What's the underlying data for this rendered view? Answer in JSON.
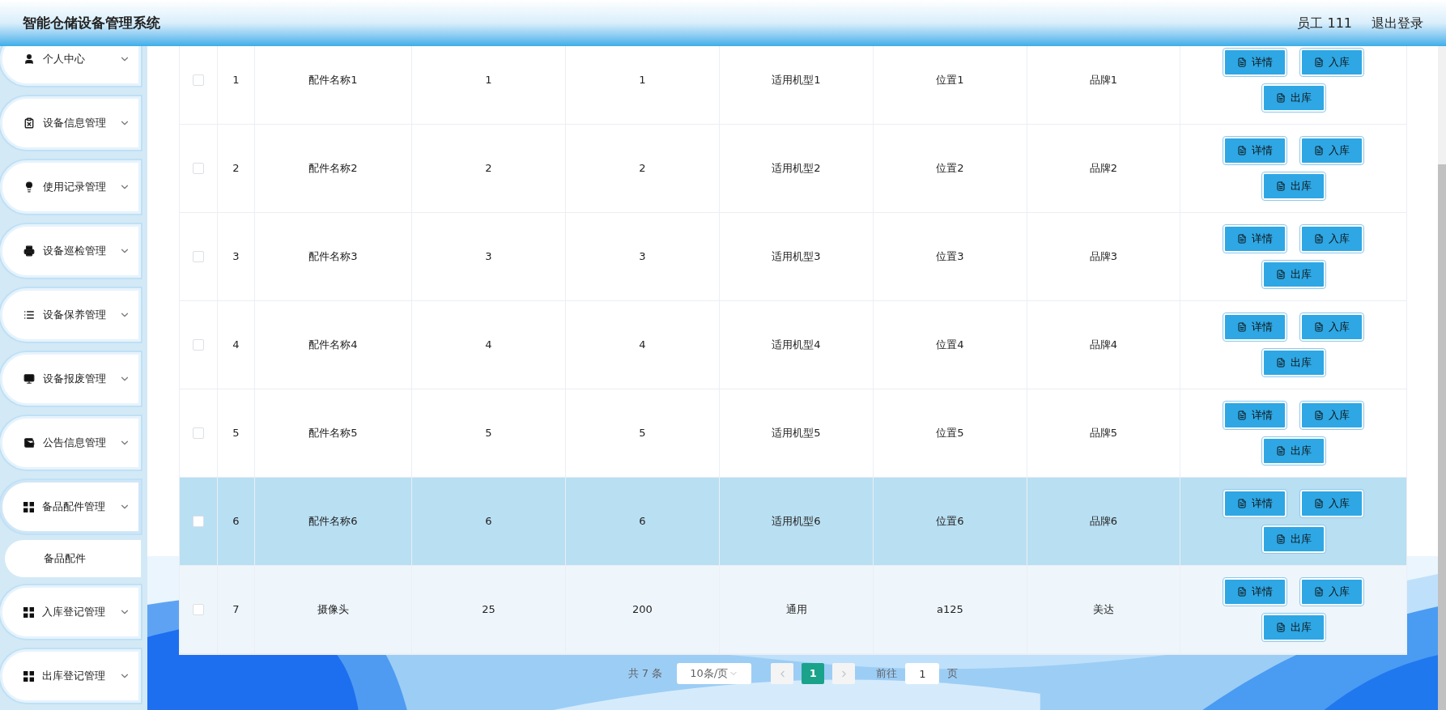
{
  "header": {
    "title": "智能仓储设备管理系统",
    "user": "员工 111",
    "logout": "退出登录"
  },
  "sidebar": {
    "items": [
      {
        "label": "个人中心",
        "expanded": false
      },
      {
        "label": "设备信息管理",
        "expanded": false
      },
      {
        "label": "使用记录管理",
        "expanded": false
      },
      {
        "label": "设备巡检管理",
        "expanded": false
      },
      {
        "label": "设备保养管理",
        "expanded": false
      },
      {
        "label": "设备报废管理",
        "expanded": false
      },
      {
        "label": "公告信息管理",
        "expanded": false
      },
      {
        "label": "备品配件管理",
        "expanded": true,
        "children": [
          {
            "label": "备品配件",
            "selected": true
          }
        ]
      },
      {
        "label": "入库登记管理",
        "expanded": false
      },
      {
        "label": "出库登记管理",
        "expanded": false
      }
    ]
  },
  "table": {
    "rows": [
      {
        "checked": false,
        "selected": false,
        "hovered": false,
        "cells": [
          "1",
          "配件名称1",
          "1",
          "1",
          "适用机型1",
          "位置1",
          "品牌1"
        ],
        "actions": [
          "详情",
          "入库",
          "出库"
        ]
      },
      {
        "checked": false,
        "selected": false,
        "hovered": false,
        "cells": [
          "2",
          "配件名称2",
          "2",
          "2",
          "适用机型2",
          "位置2",
          "品牌2"
        ],
        "actions": [
          "详情",
          "入库",
          "出库"
        ]
      },
      {
        "checked": false,
        "selected": false,
        "hovered": false,
        "cells": [
          "3",
          "配件名称3",
          "3",
          "3",
          "适用机型3",
          "位置3",
          "品牌3"
        ],
        "actions": [
          "详情",
          "入库",
          "出库"
        ]
      },
      {
        "checked": false,
        "selected": false,
        "hovered": false,
        "cells": [
          "4",
          "配件名称4",
          "4",
          "4",
          "适用机型4",
          "位置4",
          "品牌4"
        ],
        "actions": [
          "详情",
          "入库",
          "出库"
        ]
      },
      {
        "checked": false,
        "selected": false,
        "hovered": false,
        "cells": [
          "5",
          "配件名称5",
          "5",
          "5",
          "适用机型5",
          "位置5",
          "品牌5"
        ],
        "actions": [
          "详情",
          "入库",
          "出库"
        ]
      },
      {
        "checked": false,
        "selected": true,
        "hovered": false,
        "cells": [
          "6",
          "配件名称6",
          "6",
          "6",
          "适用机型6",
          "位置6",
          "品牌6"
        ],
        "actions": [
          "详情",
          "入库",
          "出库"
        ]
      },
      {
        "checked": false,
        "selected": false,
        "hovered": true,
        "cells": [
          "7",
          "摄像头",
          "25",
          "200",
          "通用",
          "a125",
          "美达"
        ],
        "actions": [
          "详情",
          "入库",
          "出库"
        ]
      }
    ]
  },
  "pagination": {
    "total": "共 7 条",
    "page_size": "10条/页",
    "pages": [
      {
        "label": "1",
        "selected": true
      }
    ],
    "goto_label": "前往",
    "goto_value": "1",
    "goto_suffix": "页"
  }
}
